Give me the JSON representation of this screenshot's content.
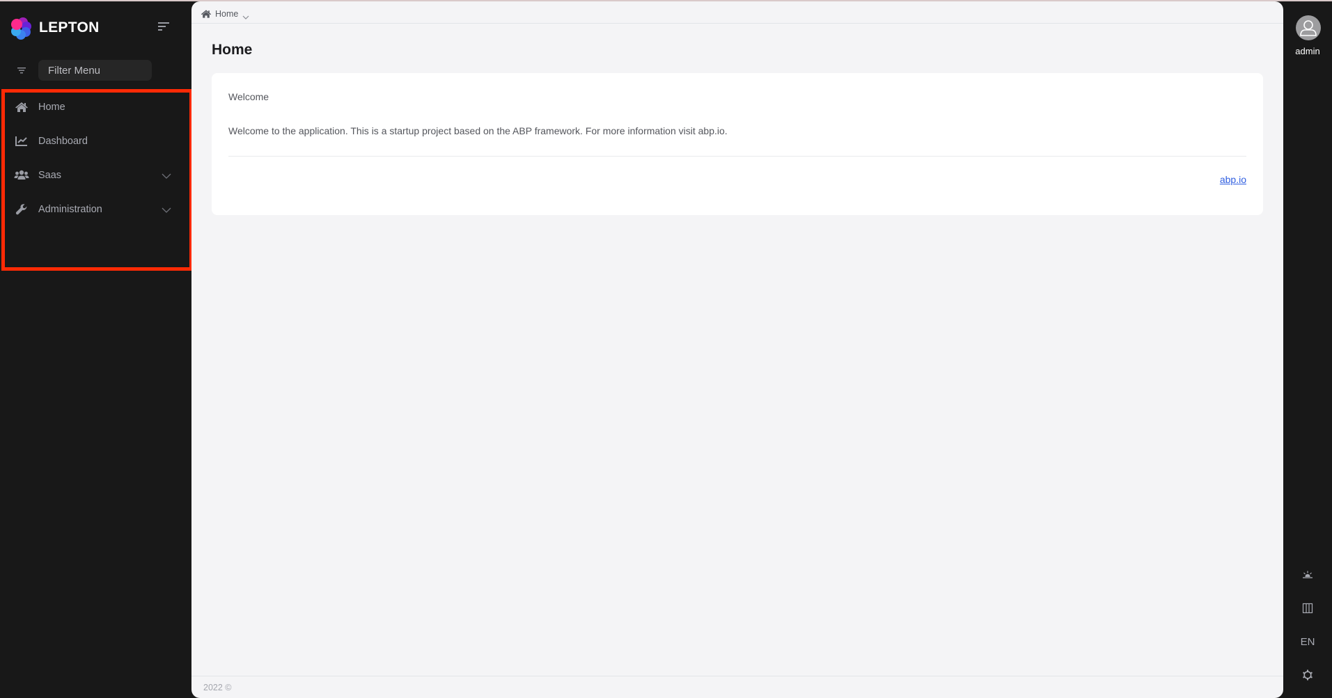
{
  "app": {
    "brand_name": "LEPTON"
  },
  "sidebar": {
    "filter_placeholder": "Filter Menu",
    "items": [
      {
        "label": "Home",
        "icon": "home-icon",
        "has_children": false
      },
      {
        "label": "Dashboard",
        "icon": "chart-line-icon",
        "has_children": false
      },
      {
        "label": "Saas",
        "icon": "users-icon",
        "has_children": true
      },
      {
        "label": "Administration",
        "icon": "wrench-icon",
        "has_children": true
      }
    ]
  },
  "breadcrumb": {
    "label": "Home"
  },
  "page": {
    "title": "Home",
    "card": {
      "title": "Welcome",
      "text": "Welcome to the application. This is a startup project based on the ABP framework. For more information visit abp.io.",
      "link_label": "abp.io"
    },
    "footer": "2022 ©"
  },
  "rail": {
    "user_name": "admin",
    "language": "EN",
    "icons": [
      "sun-icon",
      "columns-icon",
      "language",
      "gear-icon"
    ]
  },
  "colors": {
    "sidebar_bg": "#181818",
    "content_bg": "#f4f4f6",
    "highlight_border": "#ff2a05",
    "link": "#2f5ee0"
  }
}
